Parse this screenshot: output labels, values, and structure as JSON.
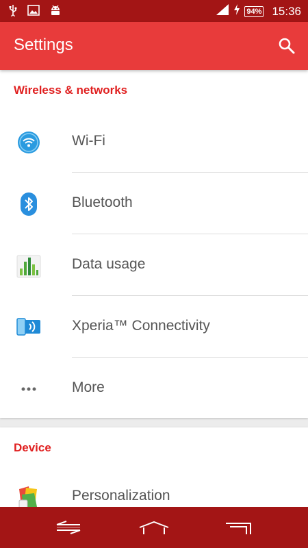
{
  "status_bar": {
    "battery": "94%",
    "time": "15:36",
    "left_icons": [
      "usb-icon",
      "image-notification-icon",
      "android-debug-icon"
    ],
    "right_icons": [
      "signal-icon",
      "charging-icon",
      "battery-icon"
    ]
  },
  "app_bar": {
    "title": "Settings",
    "search_icon": "search-icon"
  },
  "sections": {
    "wireless": {
      "header": "Wireless & networks",
      "items": [
        {
          "label": "Wi-Fi",
          "icon": "wifi-icon"
        },
        {
          "label": "Bluetooth",
          "icon": "bluetooth-icon"
        },
        {
          "label": "Data usage",
          "icon": "data-usage-icon"
        },
        {
          "label": "Xperia™ Connectivity",
          "icon": "xperia-connectivity-icon"
        },
        {
          "label": "More",
          "icon": "more-icon"
        }
      ]
    },
    "device": {
      "header": "Device",
      "items": [
        {
          "label": "Personalization",
          "icon": "personalization-icon"
        }
      ]
    }
  },
  "nav_bar": {
    "buttons": [
      "back-icon",
      "home-icon",
      "recents-icon"
    ]
  },
  "colors": {
    "status_bar": "#a31515",
    "app_bar": "#e83b3b",
    "section_header": "#e02020",
    "nav_bar": "#a31515"
  }
}
